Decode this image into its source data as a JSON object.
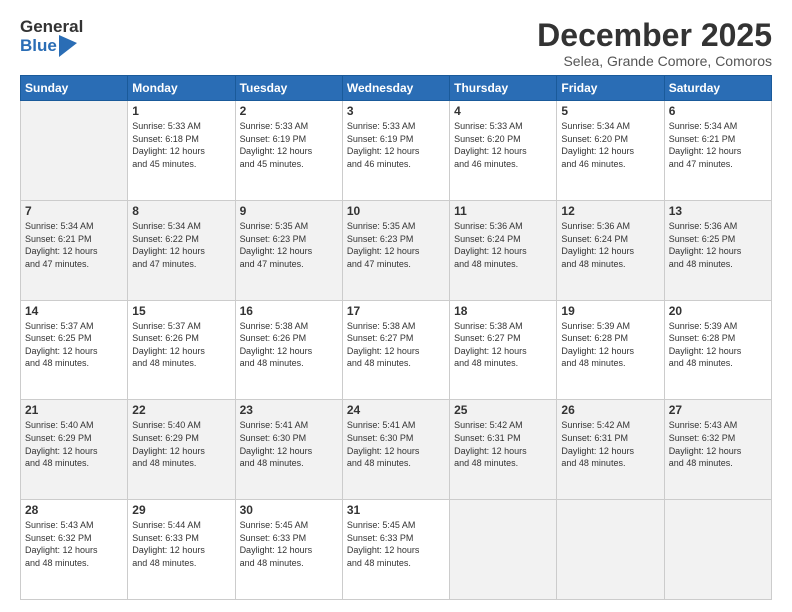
{
  "logo": {
    "general": "General",
    "blue": "Blue"
  },
  "title": "December 2025",
  "subtitle": "Selea, Grande Comore, Comoros",
  "days": [
    "Sunday",
    "Monday",
    "Tuesday",
    "Wednesday",
    "Thursday",
    "Friday",
    "Saturday"
  ],
  "weeks": [
    [
      {
        "day": "",
        "info": ""
      },
      {
        "day": "1",
        "info": "Sunrise: 5:33 AM\nSunset: 6:18 PM\nDaylight: 12 hours\nand 45 minutes."
      },
      {
        "day": "2",
        "info": "Sunrise: 5:33 AM\nSunset: 6:19 PM\nDaylight: 12 hours\nand 45 minutes."
      },
      {
        "day": "3",
        "info": "Sunrise: 5:33 AM\nSunset: 6:19 PM\nDaylight: 12 hours\nand 46 minutes."
      },
      {
        "day": "4",
        "info": "Sunrise: 5:33 AM\nSunset: 6:20 PM\nDaylight: 12 hours\nand 46 minutes."
      },
      {
        "day": "5",
        "info": "Sunrise: 5:34 AM\nSunset: 6:20 PM\nDaylight: 12 hours\nand 46 minutes."
      },
      {
        "day": "6",
        "info": "Sunrise: 5:34 AM\nSunset: 6:21 PM\nDaylight: 12 hours\nand 47 minutes."
      }
    ],
    [
      {
        "day": "7",
        "info": "Sunrise: 5:34 AM\nSunset: 6:21 PM\nDaylight: 12 hours\nand 47 minutes."
      },
      {
        "day": "8",
        "info": "Sunrise: 5:34 AM\nSunset: 6:22 PM\nDaylight: 12 hours\nand 47 minutes."
      },
      {
        "day": "9",
        "info": "Sunrise: 5:35 AM\nSunset: 6:23 PM\nDaylight: 12 hours\nand 47 minutes."
      },
      {
        "day": "10",
        "info": "Sunrise: 5:35 AM\nSunset: 6:23 PM\nDaylight: 12 hours\nand 47 minutes."
      },
      {
        "day": "11",
        "info": "Sunrise: 5:36 AM\nSunset: 6:24 PM\nDaylight: 12 hours\nand 48 minutes."
      },
      {
        "day": "12",
        "info": "Sunrise: 5:36 AM\nSunset: 6:24 PM\nDaylight: 12 hours\nand 48 minutes."
      },
      {
        "day": "13",
        "info": "Sunrise: 5:36 AM\nSunset: 6:25 PM\nDaylight: 12 hours\nand 48 minutes."
      }
    ],
    [
      {
        "day": "14",
        "info": "Sunrise: 5:37 AM\nSunset: 6:25 PM\nDaylight: 12 hours\nand 48 minutes."
      },
      {
        "day": "15",
        "info": "Sunrise: 5:37 AM\nSunset: 6:26 PM\nDaylight: 12 hours\nand 48 minutes."
      },
      {
        "day": "16",
        "info": "Sunrise: 5:38 AM\nSunset: 6:26 PM\nDaylight: 12 hours\nand 48 minutes."
      },
      {
        "day": "17",
        "info": "Sunrise: 5:38 AM\nSunset: 6:27 PM\nDaylight: 12 hours\nand 48 minutes."
      },
      {
        "day": "18",
        "info": "Sunrise: 5:38 AM\nSunset: 6:27 PM\nDaylight: 12 hours\nand 48 minutes."
      },
      {
        "day": "19",
        "info": "Sunrise: 5:39 AM\nSunset: 6:28 PM\nDaylight: 12 hours\nand 48 minutes."
      },
      {
        "day": "20",
        "info": "Sunrise: 5:39 AM\nSunset: 6:28 PM\nDaylight: 12 hours\nand 48 minutes."
      }
    ],
    [
      {
        "day": "21",
        "info": "Sunrise: 5:40 AM\nSunset: 6:29 PM\nDaylight: 12 hours\nand 48 minutes."
      },
      {
        "day": "22",
        "info": "Sunrise: 5:40 AM\nSunset: 6:29 PM\nDaylight: 12 hours\nand 48 minutes."
      },
      {
        "day": "23",
        "info": "Sunrise: 5:41 AM\nSunset: 6:30 PM\nDaylight: 12 hours\nand 48 minutes."
      },
      {
        "day": "24",
        "info": "Sunrise: 5:41 AM\nSunset: 6:30 PM\nDaylight: 12 hours\nand 48 minutes."
      },
      {
        "day": "25",
        "info": "Sunrise: 5:42 AM\nSunset: 6:31 PM\nDaylight: 12 hours\nand 48 minutes."
      },
      {
        "day": "26",
        "info": "Sunrise: 5:42 AM\nSunset: 6:31 PM\nDaylight: 12 hours\nand 48 minutes."
      },
      {
        "day": "27",
        "info": "Sunrise: 5:43 AM\nSunset: 6:32 PM\nDaylight: 12 hours\nand 48 minutes."
      }
    ],
    [
      {
        "day": "28",
        "info": "Sunrise: 5:43 AM\nSunset: 6:32 PM\nDaylight: 12 hours\nand 48 minutes."
      },
      {
        "day": "29",
        "info": "Sunrise: 5:44 AM\nSunset: 6:33 PM\nDaylight: 12 hours\nand 48 minutes."
      },
      {
        "day": "30",
        "info": "Sunrise: 5:45 AM\nSunset: 6:33 PM\nDaylight: 12 hours\nand 48 minutes."
      },
      {
        "day": "31",
        "info": "Sunrise: 5:45 AM\nSunset: 6:33 PM\nDaylight: 12 hours\nand 48 minutes."
      },
      {
        "day": "",
        "info": ""
      },
      {
        "day": "",
        "info": ""
      },
      {
        "day": "",
        "info": ""
      }
    ]
  ]
}
